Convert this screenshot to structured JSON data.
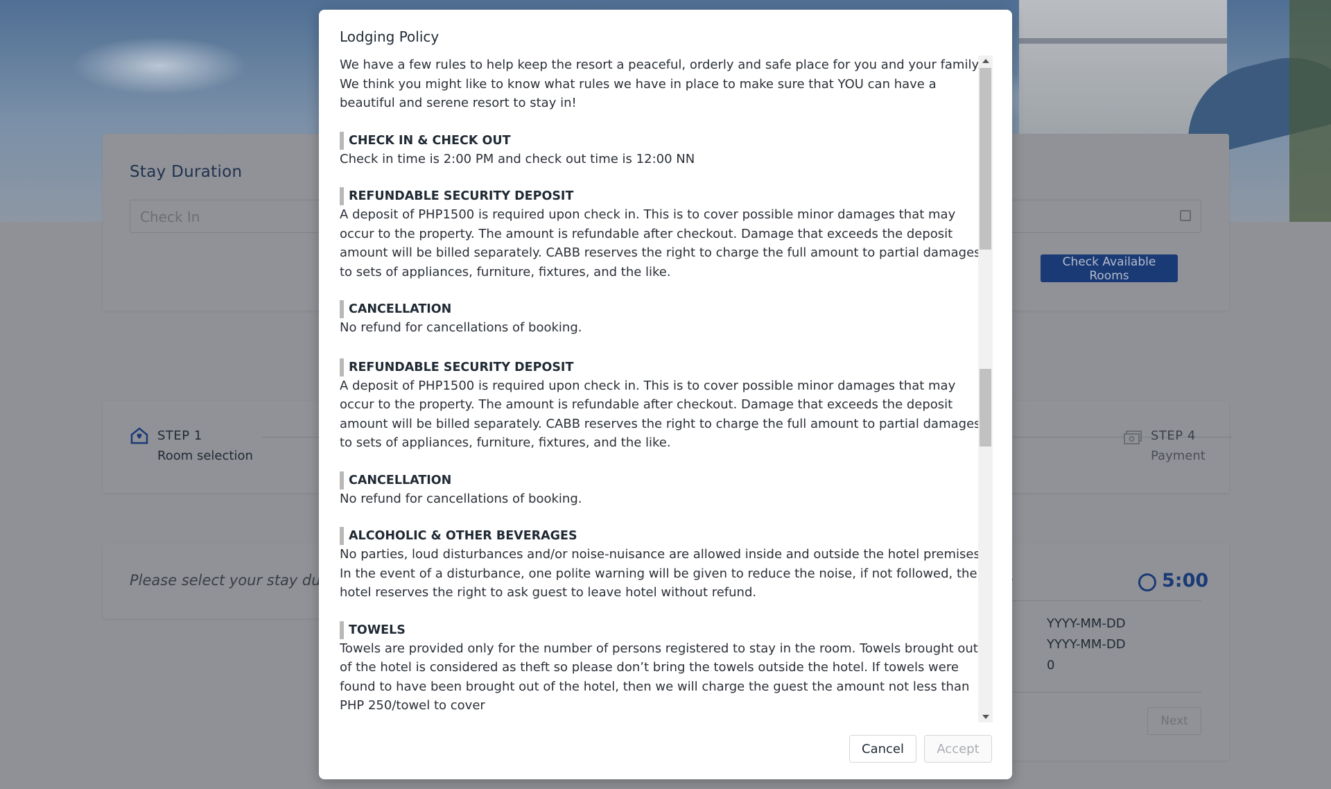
{
  "stay": {
    "title": "Stay Duration",
    "check_in_placeholder": "Check In",
    "check_out_placeholder": "",
    "check_button": "Check Available Rooms"
  },
  "steps": [
    {
      "label": "STEP 1",
      "sub": "Room selection",
      "icon": "home-icon"
    },
    {
      "label": "STEP 4",
      "sub": "Payment",
      "icon": "cash-icon"
    }
  ],
  "selection_prompt": "Please select your stay durat",
  "summary": {
    "title": "ary",
    "timer": "5:00",
    "values": [
      "YYYY-MM-DD",
      "YYYY-MM-DD",
      "0"
    ],
    "next_button": "Next"
  },
  "modal": {
    "title": "Lodging Policy",
    "intro": "We have a few rules to help keep the resort a peaceful, orderly and safe place for you and your family. We think you might like to know what rules we have in place to make sure that YOU can have a beautiful and serene resort to stay in!",
    "sections": [
      {
        "heading": "CHECK IN & CHECK OUT",
        "body": "Check in time is 2:00 PM and check out time is 12:00 NN"
      },
      {
        "heading": "REFUNDABLE SECURITY DEPOSIT",
        "body": "A deposit of PHP1500 is required upon check in. This is to cover possible minor damages that may occur to the property. The amount is refundable after checkout. Damage that exceeds the deposit amount will be billed separately. CABB reserves the right to charge the full amount to partial damages to sets of appliances, furniture, fixtures, and the like."
      },
      {
        "heading": "CANCELLATION",
        "body": "No refund for cancellations of booking."
      },
      {
        "heading": "REFUNDABLE SECURITY DEPOSIT",
        "body": "A deposit of PHP1500 is required upon check in. This is to cover possible minor damages that may occur to the property. The amount is refundable after checkout. Damage that exceeds the deposit amount will be billed separately. CABB reserves the right to charge the full amount to partial damages to sets of appliances, furniture, fixtures, and the like."
      },
      {
        "heading": "CANCELLATION",
        "body": "No refund for cancellations of booking."
      },
      {
        "heading": "ALCOHOLIC & OTHER BEVERAGES",
        "body": "No parties, loud disturbances and/or noise-nuisance are allowed inside and outside the hotel premises. In the event of a disturbance, one polite warning will be given to reduce the noise, if not followed, the hotel reserves the right to ask guest to leave hotel without refund."
      },
      {
        "heading": "TOWELS",
        "body": "Towels are provided only for the number of persons registered to stay in the room. Towels brought out of the hotel is considered as theft so please don’t bring the towels outside the hotel. If towels were found to have been brought out of the hotel, then we will charge the guest the amount not less than PHP 250/towel to cover"
      }
    ],
    "cancel_button": "Cancel",
    "accept_button": "Accept"
  }
}
